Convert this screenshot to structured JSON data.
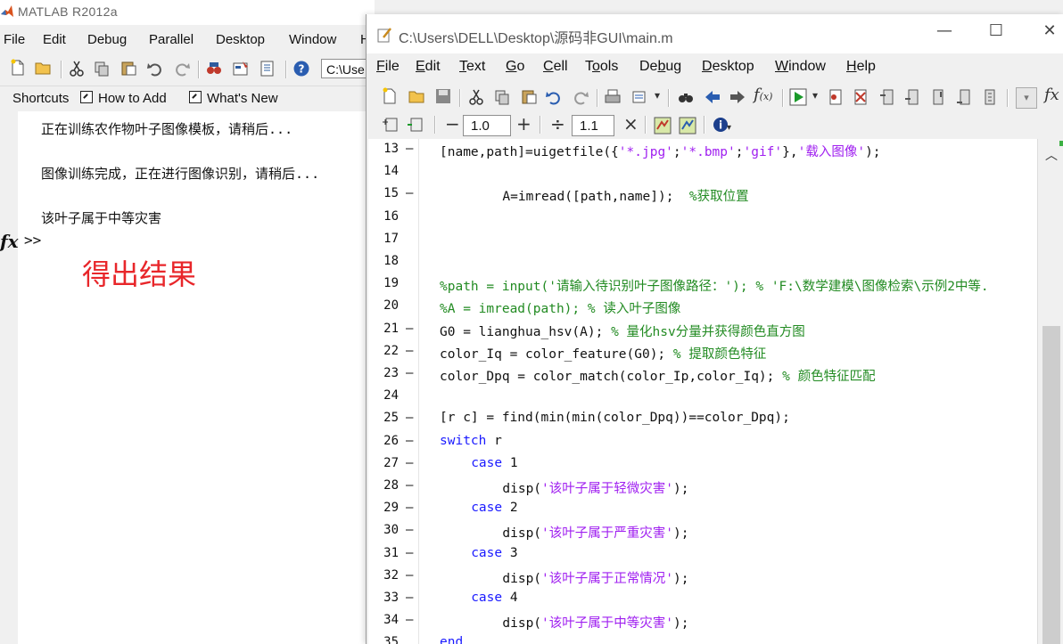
{
  "matlab": {
    "title": "MATLAB  R2012a",
    "menus": [
      "File",
      "Edit",
      "Debug",
      "Parallel",
      "Desktop",
      "Window",
      "H"
    ],
    "current_dir": "C:\\Use",
    "shortcuts": [
      "Shortcuts",
      "How to Add",
      "What's New"
    ],
    "command_output": [
      "正在训练农作物叶子图像模板，请稍后...",
      "图像训练完成，正在进行图像识别，请稍后...",
      "该叶子属于中等灾害"
    ],
    "prompt_fx": "fx",
    "prompt": ">>",
    "annotation": "得出结果"
  },
  "editor": {
    "title": "C:\\Users\\DELL\\Desktop\\源码非GUI\\main.m",
    "menus": [
      {
        "u": "F",
        "rest": "ile"
      },
      {
        "u": "E",
        "rest": "dit"
      },
      {
        "u": "T",
        "rest": "ext"
      },
      {
        "u": "G",
        "rest": "o"
      },
      {
        "u": "C",
        "rest": "ell"
      },
      {
        "pre": "T",
        "u": "o",
        "rest": "ols"
      },
      {
        "pre": "De",
        "u": "b",
        "rest": "ug"
      },
      {
        "u": "D",
        "rest": "esktop"
      },
      {
        "u": "W",
        "rest": "indow"
      },
      {
        "u": "H",
        "rest": "elp"
      }
    ],
    "toolbar2": {
      "minus": "−",
      "value1": "1.0",
      "plus": "+",
      "divide": "÷",
      "value2": "1.1",
      "times": "×"
    },
    "code_lines": [
      {
        "n": "13",
        "dash": true,
        "indent": 0,
        "parts": [
          [
            "t",
            "[name,path]=uigetfile({"
          ],
          [
            "s",
            "'*.jpg'"
          ],
          [
            "t",
            ";"
          ],
          [
            "s",
            "'*.bmp'"
          ],
          [
            "t",
            ";"
          ],
          [
            "s",
            "'gif'"
          ],
          [
            "t",
            "},"
          ],
          [
            "s",
            "'载入图像'"
          ],
          [
            "t",
            ");"
          ]
        ]
      },
      {
        "n": "14",
        "dash": false,
        "indent": 0,
        "parts": []
      },
      {
        "n": "15",
        "dash": true,
        "indent": 8,
        "parts": [
          [
            "t",
            "A=imread([path,name]);  "
          ],
          [
            "c",
            "%获取位置"
          ]
        ]
      },
      {
        "n": "16",
        "dash": false,
        "indent": 0,
        "parts": []
      },
      {
        "n": "17",
        "dash": false,
        "indent": 0,
        "parts": []
      },
      {
        "n": "18",
        "dash": false,
        "indent": 0,
        "parts": []
      },
      {
        "n": "19",
        "dash": false,
        "indent": 0,
        "parts": [
          [
            "c",
            "%path = input('请输入待识别叶子图像路径：'); % 'F:\\数学建模\\图像检索\\示例2中等."
          ]
        ]
      },
      {
        "n": "20",
        "dash": false,
        "indent": 0,
        "parts": [
          [
            "c",
            "%A = imread(path); % 读入叶子图像"
          ]
        ]
      },
      {
        "n": "21",
        "dash": true,
        "indent": 0,
        "parts": [
          [
            "t",
            "G0 = lianghua_hsv(A); "
          ],
          [
            "c",
            "% 量化hsv分量并获得颜色直方图"
          ]
        ]
      },
      {
        "n": "22",
        "dash": true,
        "indent": 0,
        "parts": [
          [
            "t",
            "color_Iq = color_feature(G0); "
          ],
          [
            "c",
            "% 提取颜色特征"
          ]
        ]
      },
      {
        "n": "23",
        "dash": true,
        "indent": 0,
        "parts": [
          [
            "t",
            "color_Dpq = color_match(color_Ip,color_Iq); "
          ],
          [
            "c",
            "% 颜色特征匹配"
          ]
        ]
      },
      {
        "n": "24",
        "dash": false,
        "indent": 0,
        "parts": []
      },
      {
        "n": "25",
        "dash": true,
        "indent": 0,
        "parts": [
          [
            "t",
            "[r c] = find(min(min(color_Dpq))==color_Dpq);"
          ]
        ]
      },
      {
        "n": "26",
        "dash": true,
        "indent": 0,
        "parts": [
          [
            "k",
            "switch"
          ],
          [
            "t",
            " r"
          ]
        ]
      },
      {
        "n": "27",
        "dash": true,
        "indent": 4,
        "parts": [
          [
            "k",
            "case"
          ],
          [
            "t",
            " 1"
          ]
        ]
      },
      {
        "n": "28",
        "dash": true,
        "indent": 8,
        "parts": [
          [
            "t",
            "disp("
          ],
          [
            "s",
            "'该叶子属于轻微灾害'"
          ],
          [
            "t",
            ");"
          ]
        ]
      },
      {
        "n": "29",
        "dash": true,
        "indent": 4,
        "parts": [
          [
            "k",
            "case"
          ],
          [
            "t",
            " 2"
          ]
        ]
      },
      {
        "n": "30",
        "dash": true,
        "indent": 8,
        "parts": [
          [
            "t",
            "disp("
          ],
          [
            "s",
            "'该叶子属于严重灾害'"
          ],
          [
            "t",
            ");"
          ]
        ]
      },
      {
        "n": "31",
        "dash": true,
        "indent": 4,
        "parts": [
          [
            "k",
            "case"
          ],
          [
            "t",
            " 3"
          ]
        ]
      },
      {
        "n": "32",
        "dash": true,
        "indent": 8,
        "parts": [
          [
            "t",
            "disp("
          ],
          [
            "s",
            "'该叶子属于正常情况'"
          ],
          [
            "t",
            ");"
          ]
        ]
      },
      {
        "n": "33",
        "dash": true,
        "indent": 4,
        "parts": [
          [
            "k",
            "case"
          ],
          [
            "t",
            " 4"
          ]
        ]
      },
      {
        "n": "34",
        "dash": true,
        "indent": 8,
        "parts": [
          [
            "t",
            "disp("
          ],
          [
            "s",
            "'该叶子属于中等灾害'"
          ],
          [
            "t",
            ");"
          ]
        ]
      },
      {
        "n": "35",
        "dash": false,
        "indent": 0,
        "parts": [
          [
            "k",
            "end"
          ]
        ]
      }
    ]
  },
  "icons": [
    "matlab-logo-icon",
    "new-file-icon",
    "open-folder-icon",
    "cut-icon",
    "copy-icon",
    "paste-icon",
    "undo-icon",
    "redo-icon",
    "simulink-icon",
    "guide-icon",
    "profiler-icon",
    "help-icon",
    "save-icon",
    "print-icon",
    "find-icon",
    "back-icon",
    "forward-icon",
    "function-icon",
    "run-icon",
    "breakpoint-icon",
    "cell-icon"
  ],
  "colors": {
    "keyword": "#1a1aff",
    "string": "#a020f0",
    "comment": "#228b22",
    "annotation": "#e8262a"
  }
}
